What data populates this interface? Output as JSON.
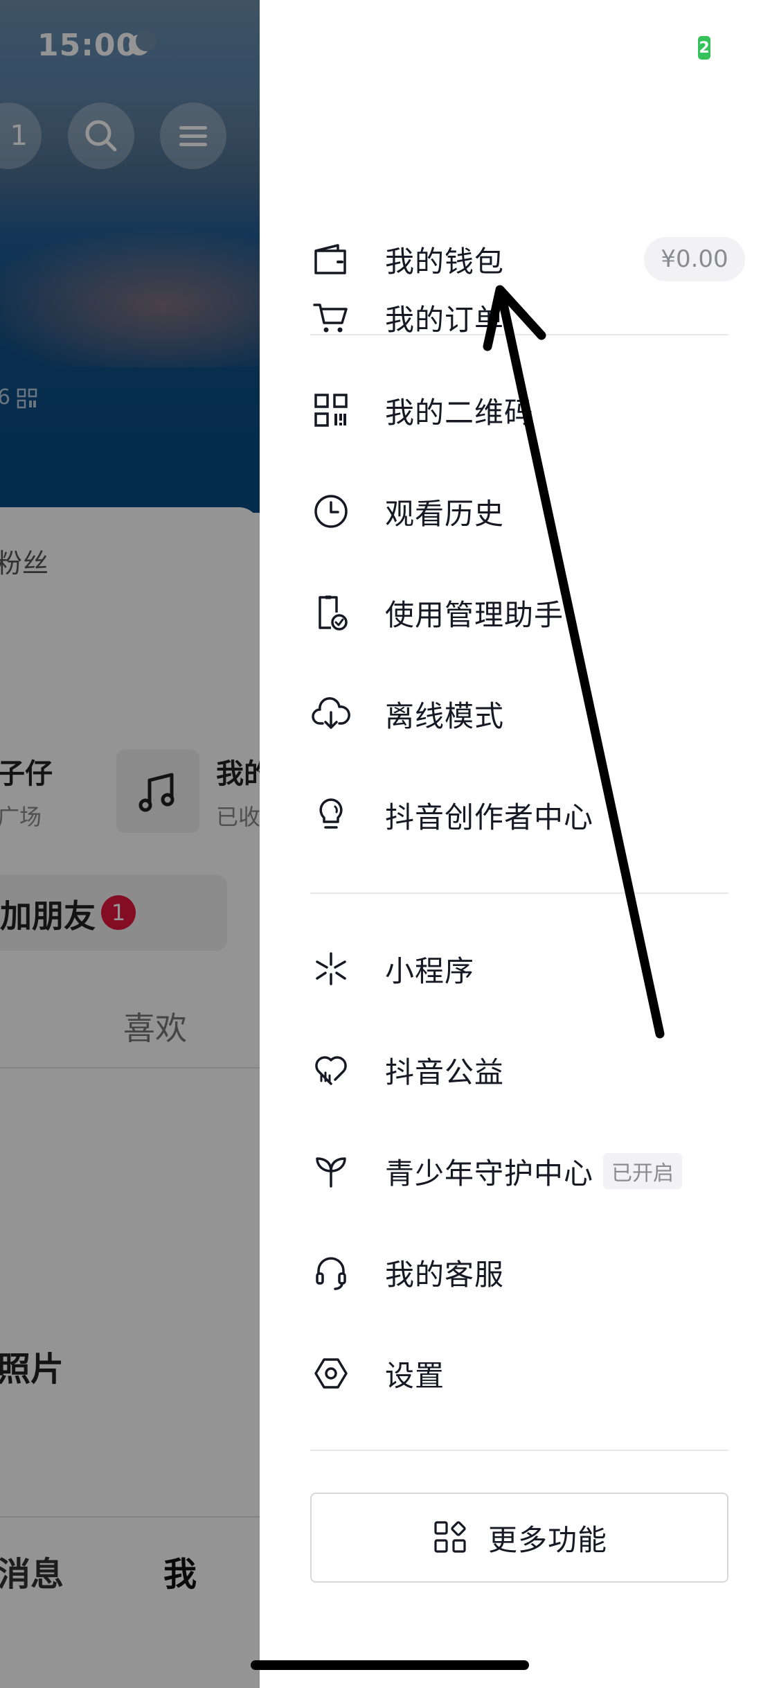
{
  "status_bar": {
    "time": "15:00",
    "battery_text": "2"
  },
  "background": {
    "counter_text": "1",
    "fans_fragment": "粉丝",
    "name_fragment": "子仔",
    "name_sub_fragment": "广场",
    "music_title_fragment": "我的",
    "music_sub_fragment": "已收",
    "add_friend_label": "加朋友",
    "add_friend_badge": "1",
    "tab_like": "喜欢",
    "photo_fragment": "照片",
    "nav_messages": "消息",
    "nav_me": "我"
  },
  "drawer": {
    "items": [
      {
        "label": "我的订单",
        "icon": "cart-icon"
      },
      {
        "label": "我的钱包",
        "icon": "wallet-icon",
        "value": "¥0.00"
      },
      {
        "label": "我的二维码",
        "icon": "qr-code-icon"
      },
      {
        "label": "观看历史",
        "icon": "clock-icon"
      },
      {
        "label": "使用管理助手",
        "icon": "phone-check-icon"
      },
      {
        "label": "离线模式",
        "icon": "cloud-download-icon"
      },
      {
        "label": "抖音创作者中心",
        "icon": "lightbulb-icon"
      },
      {
        "label": "小程序",
        "icon": "mini-program-icon"
      },
      {
        "label": "抖音公益",
        "icon": "heart-chart-icon"
      },
      {
        "label": "青少年守护中心",
        "icon": "sprout-icon",
        "tag": "已开启"
      },
      {
        "label": "我的客服",
        "icon": "headset-icon"
      },
      {
        "label": "设置",
        "icon": "settings-hexagon-icon"
      }
    ],
    "more_button": {
      "label": "更多功能",
      "icon": "apps-icon"
    }
  },
  "colors": {
    "accent_battery": "#35c25a",
    "badge_red": "#e3173e",
    "text_primary": "#161823",
    "annotation_arrow": "#000000"
  }
}
